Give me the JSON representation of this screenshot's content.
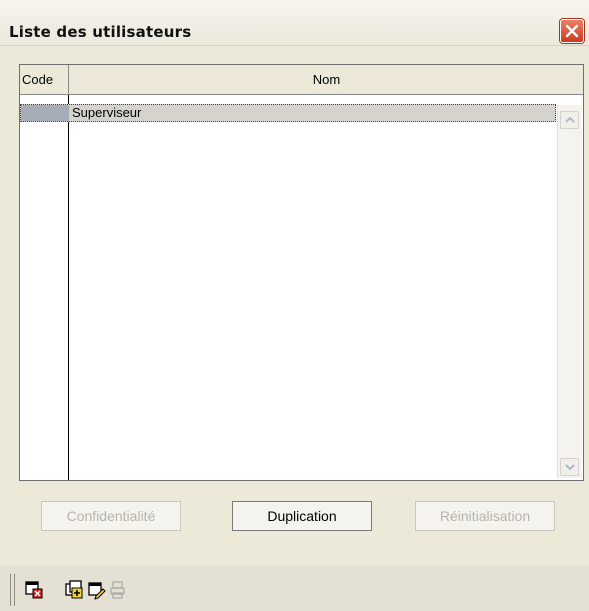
{
  "window": {
    "title": "Liste des utilisateurs",
    "close_icon": "close-icon"
  },
  "grid": {
    "columns": [
      "Code",
      "Nom"
    ],
    "rows": [
      {
        "code": "",
        "name": "Superviseur",
        "selected": true
      }
    ]
  },
  "buttons": {
    "confidentialite": {
      "label": "Confidentialité",
      "enabled": false
    },
    "duplication": {
      "label": "Duplication",
      "enabled": true
    },
    "reinitialisation": {
      "label": "Réinitialisation",
      "enabled": false
    }
  },
  "toolbar": {
    "icons": [
      "delete-user-icon",
      "add-user-icon",
      "edit-user-icon",
      "print-icon"
    ]
  },
  "colors": {
    "close_button": "#d4472a",
    "selection": "#d5d3cd",
    "window_bg": "#ece9d8"
  }
}
